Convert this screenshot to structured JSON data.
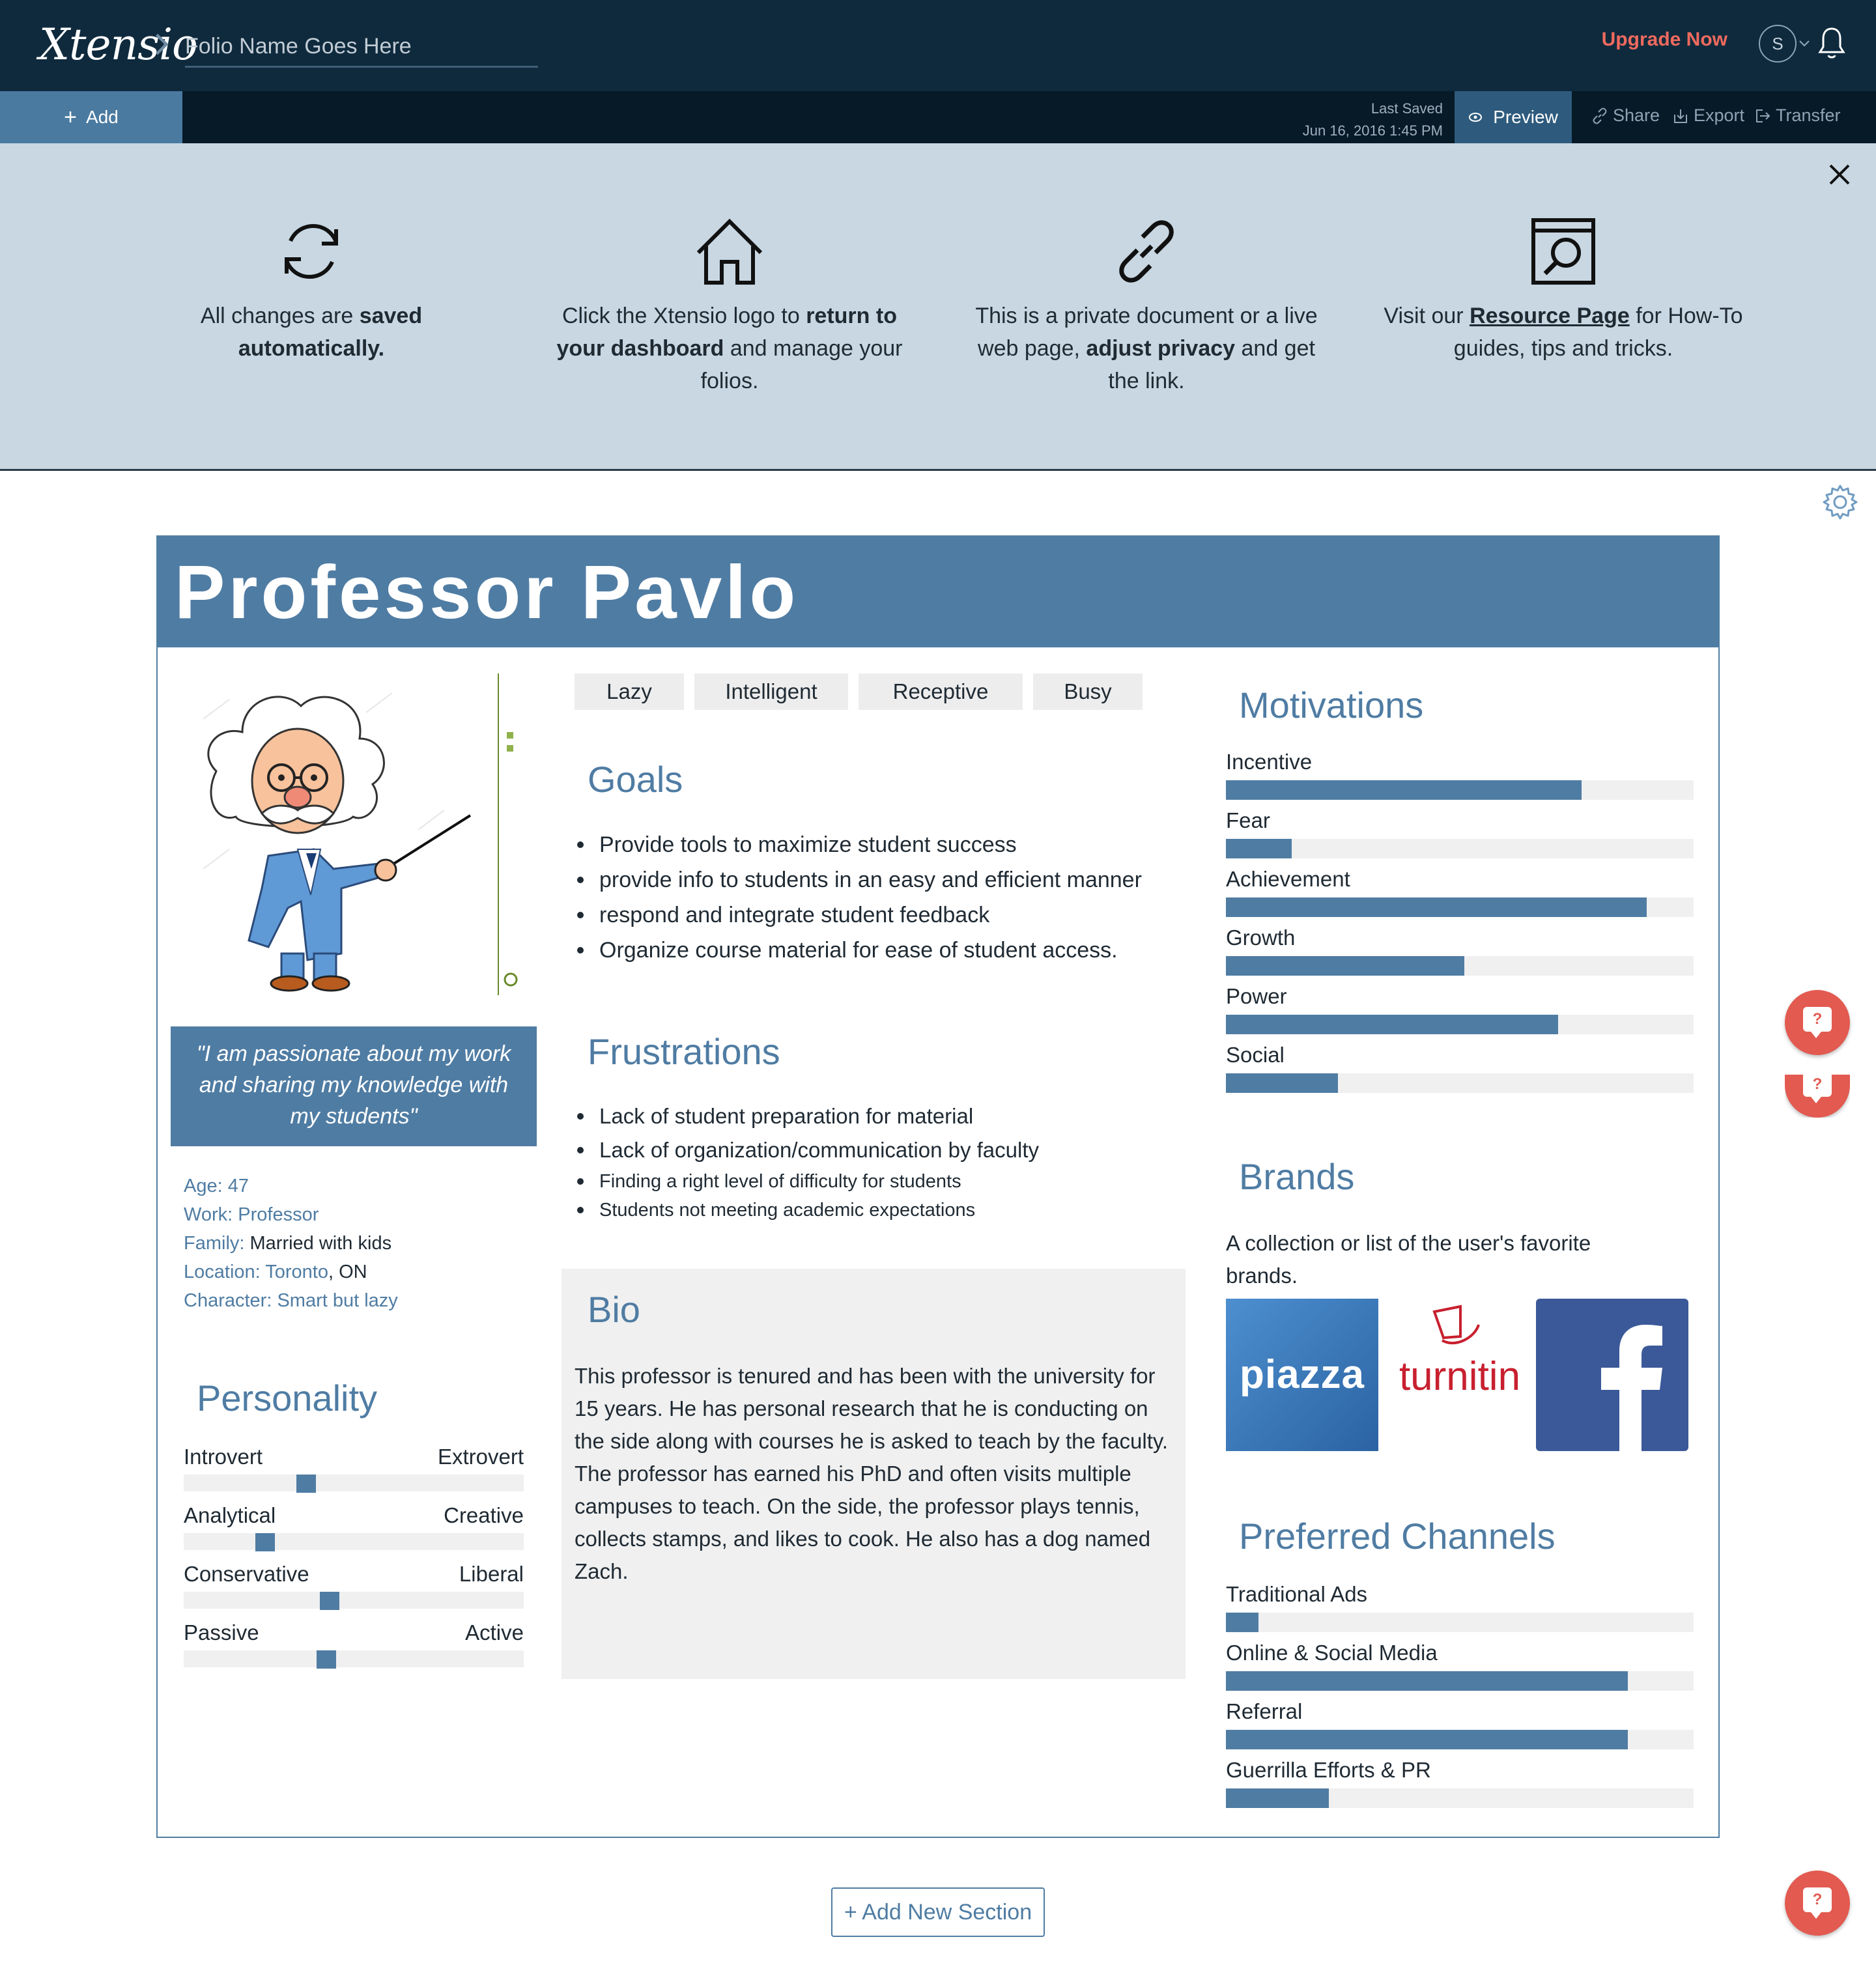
{
  "header": {
    "logo": "Xtensio",
    "folio_name": "Folio Name Goes Here",
    "upgrade_label": "Upgrade Now",
    "avatar_initial": "S"
  },
  "toolbar": {
    "add_label": "Add",
    "last_saved_label": "Last Saved",
    "last_saved_time": "Jun 16, 2016 1:45 PM",
    "preview_label": "Preview",
    "share_label": "Share",
    "export_label": "Export",
    "transfer_label": "Transfer"
  },
  "tips": [
    {
      "icon": "refresh-icon",
      "pre": "All changes are ",
      "bold": "saved automatically.",
      "post": ""
    },
    {
      "icon": "home-icon",
      "pre": "Click the Xtensio logo to ",
      "bold": "return to your dashboard",
      "post": " and manage your folios."
    },
    {
      "icon": "link-icon",
      "pre": "This is a private document or a live web page, ",
      "bold": "adjust privacy",
      "post": " and get the link."
    },
    {
      "icon": "resource-search-icon",
      "pre": "Visit our ",
      "link": "Resource Page",
      "post": " for How-To guides, tips and tricks."
    }
  ],
  "persona": {
    "name": "Professor Pavlo",
    "quote": "\"I am passionate about my work and sharing my knowledge with my students\"",
    "facts": [
      {
        "label": "Age:",
        "value": " 47",
        "value_style": "blue"
      },
      {
        "label": "Work:",
        "value": " Professor",
        "value_style": "blue"
      },
      {
        "label": "Family:",
        "value": " Married with kids",
        "value_style": "dark"
      },
      {
        "label": "Location:",
        "value": " Toronto",
        "value_suffix": ", ON",
        "value_style": "blue"
      },
      {
        "label": "Character:",
        "value": " Smart but lazy",
        "value_style": "blue"
      }
    ],
    "personality_title": "Personality",
    "personality": [
      {
        "left": "Introvert",
        "right": "Extrovert",
        "position": 0.36
      },
      {
        "left": "Analytical",
        "right": "Creative",
        "position": 0.24
      },
      {
        "left": "Conservative",
        "right": "Liberal",
        "position": 0.43
      },
      {
        "left": "Passive",
        "right": "Active",
        "position": 0.42
      }
    ],
    "tags": [
      "Lazy",
      "Intelligent",
      "Receptive",
      "Busy"
    ],
    "goals_title": "Goals",
    "goals": [
      "Provide tools to maximize student success",
      "provide info to students in an easy and efficient manner",
      "respond and integrate student feedback",
      "Organize course material for ease of student access."
    ],
    "frustrations_title": "Frustrations",
    "frustrations": [
      "Lack of student preparation for material",
      "Lack of organization/communication by faculty",
      "Finding a right level of difficulty for students",
      "Students not meeting academic expectations"
    ],
    "bio_title": "Bio",
    "bio": "This professor is tenured and has been with the university for 15 years. He has personal research that he is conducting on the side along with courses he is asked to teach by the faculty. The professor has earned his PhD and often visits multiple campuses to teach. On the side, the professor plays tennis, collects stamps, and likes to cook. He also has a dog named Zach.",
    "motivations_title": "Motivations",
    "motivations": [
      {
        "label": "Incentive",
        "value": 0.76
      },
      {
        "label": "Fear",
        "value": 0.14
      },
      {
        "label": "Achievement",
        "value": 0.9
      },
      {
        "label": "Growth",
        "value": 0.51
      },
      {
        "label": "Power",
        "value": 0.71
      },
      {
        "label": "Social",
        "value": 0.24
      }
    ],
    "brands_title": "Brands",
    "brands_desc": "A collection or list of the user's favorite brands.",
    "brands": [
      "piazza",
      "turnitin",
      "facebook"
    ],
    "channels_title": "Preferred Channels",
    "channels": [
      {
        "label": "Traditional Ads",
        "value": 0.07
      },
      {
        "label": "Online & Social Media",
        "value": 0.86
      },
      {
        "label": "Referral",
        "value": 0.86
      },
      {
        "label": "Guerrilla Efforts & PR",
        "value": 0.22
      }
    ]
  },
  "add_section_label": "+ Add New Section",
  "help_label": "?",
  "colors": {
    "accent": "#4f7ca3",
    "topbar": "#0f2a3d",
    "upgrade": "#ef6a5e",
    "help": "#e25a50",
    "tips_bg": "#c8d7e2"
  }
}
